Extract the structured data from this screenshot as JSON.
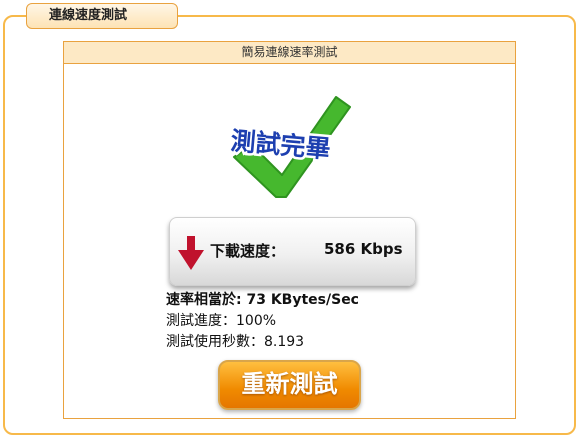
{
  "window": {
    "title": "連線速度測試"
  },
  "panel": {
    "header": "簡易連線速率測試"
  },
  "result": {
    "badge_text": "測試完畢"
  },
  "speed": {
    "label": "下載速度：",
    "value": "586 Kbps"
  },
  "info": {
    "rate": "速率相當於: 73 KBytes/Sec",
    "progress": "測試進度：100%",
    "elapsed": "測試使用秒數：8.193"
  },
  "actions": {
    "retest_label": "重新測試"
  },
  "colors": {
    "frame_border": "#f7b94a",
    "header_bg": "#fde9c5",
    "check_green": "#46b82e",
    "badge_blue": "#1d3fb0",
    "arrow_red": "#c0122d",
    "button_orange": "#f08a00"
  },
  "icons": {
    "check": "checkmark-icon",
    "download": "down-arrow-icon"
  }
}
